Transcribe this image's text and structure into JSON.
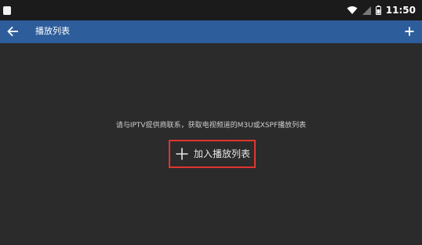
{
  "status_bar": {
    "time": "11:50",
    "icons": [
      "notification-square-icon",
      "wifi-icon",
      "cellular-signal-icon",
      "battery-icon"
    ]
  },
  "app_bar": {
    "title": "播放列表",
    "back_icon": "arrow-left-icon",
    "add_icon": "plus-icon",
    "color": "#2d5d9b"
  },
  "main": {
    "hint": "请与IPTV提供商联系，获取电视频道的M3U或XSPF播放列表",
    "add_button_label": "加入播放列表",
    "add_button_icon": "plus-icon",
    "highlight_color": "#e0352f"
  }
}
